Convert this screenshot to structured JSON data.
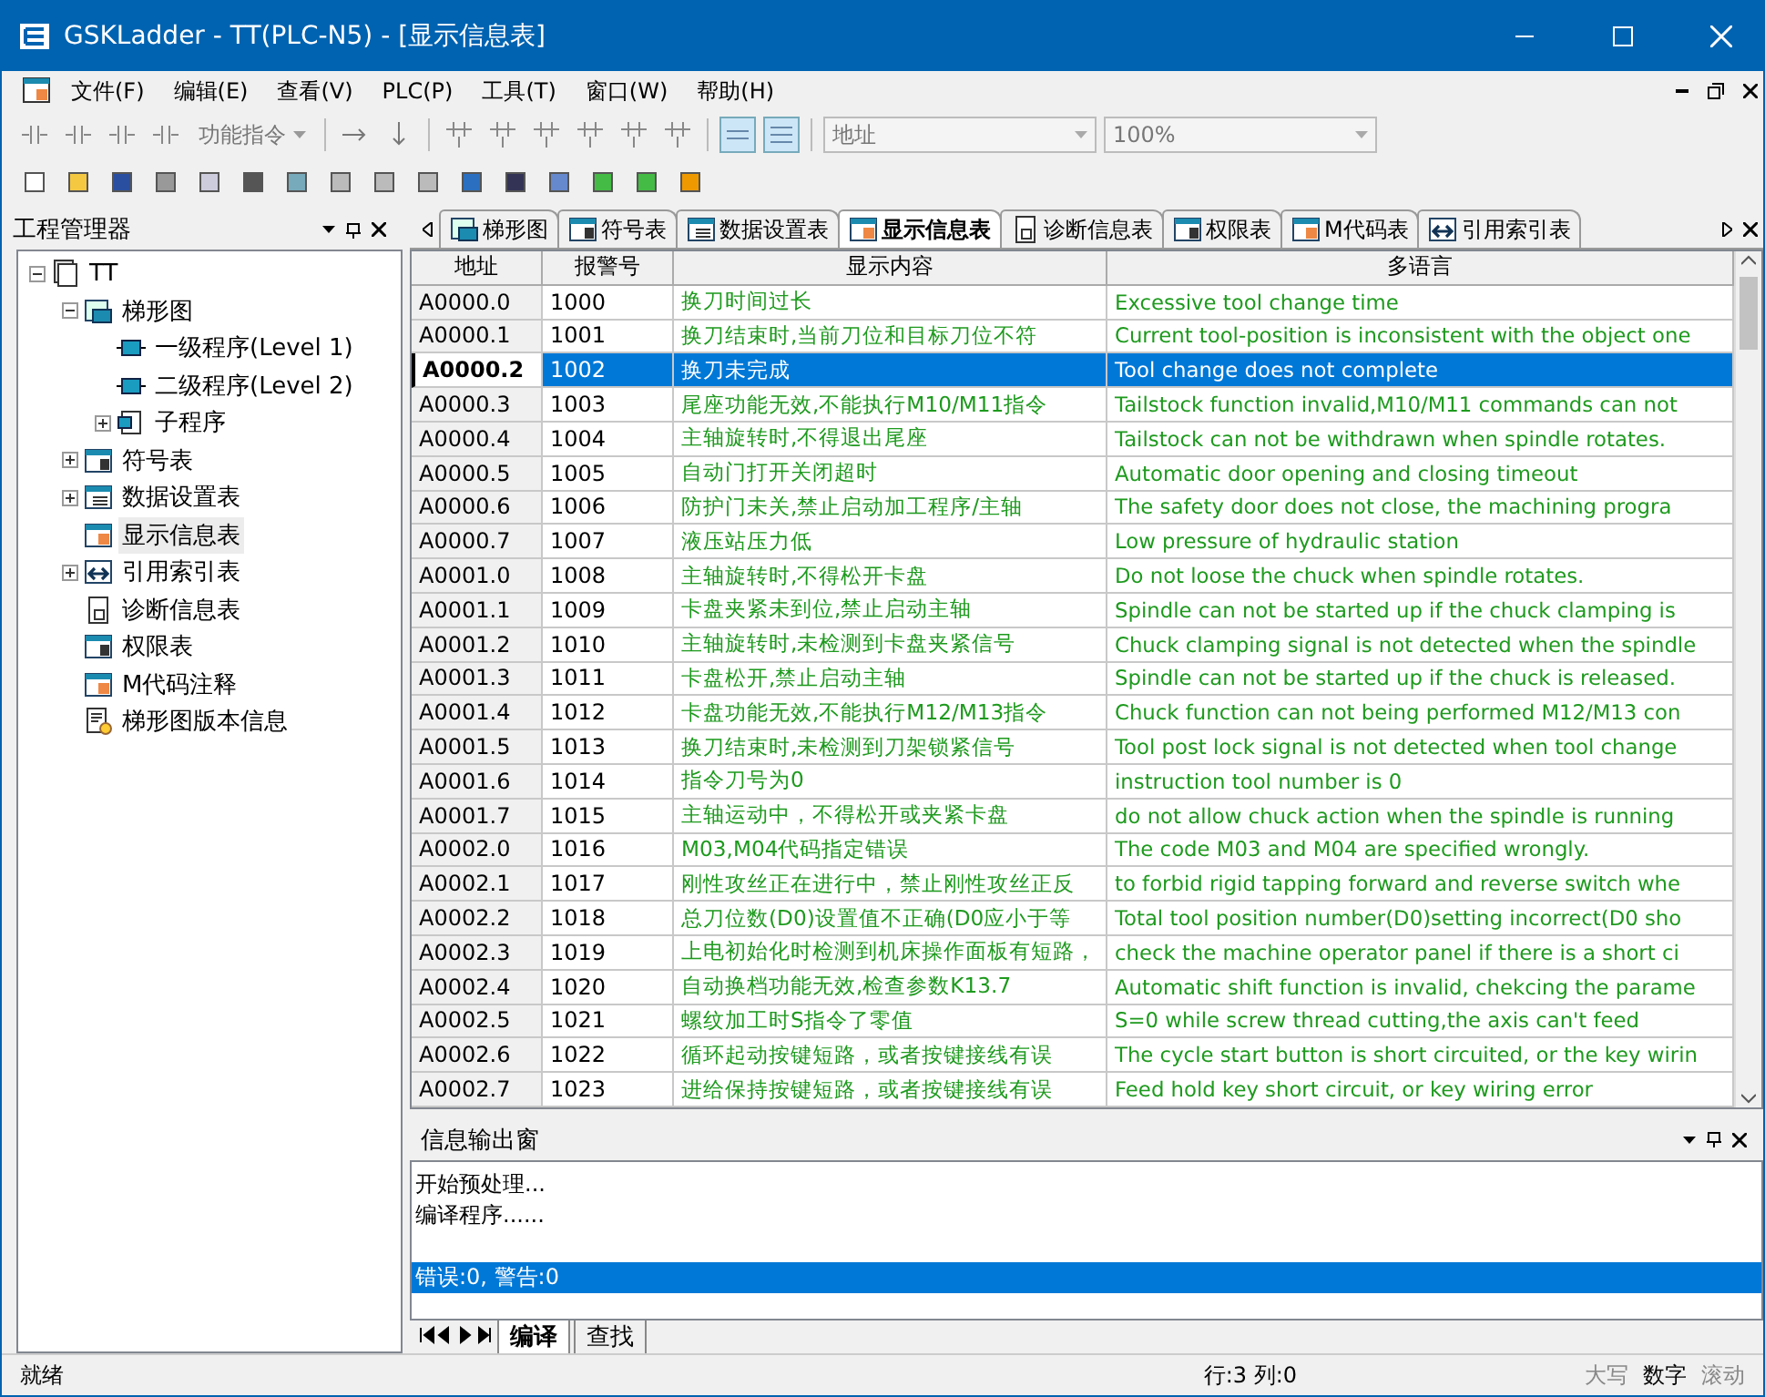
{
  "window": {
    "title": "GSKLadder - TT(PLC-N5) - [显示信息表]"
  },
  "menu": [
    "文件(F)",
    "编辑(E)",
    "查看(V)",
    "PLC(P)",
    "工具(T)",
    "窗口(W)",
    "帮助(H)"
  ],
  "toolbar": {
    "function_menu": "功能指令",
    "address_combo": "地址",
    "zoom_combo": "100%"
  },
  "project_panel": {
    "title": "工程管理器",
    "tree": [
      {
        "label": "TT",
        "kind": "project",
        "expanded": true,
        "selected": false,
        "children": [
          {
            "label": "梯形图",
            "kind": "folder",
            "expanded": true,
            "selected": false,
            "children": [
              {
                "label": "一级程序(Level 1)",
                "kind": "block",
                "selected": false
              },
              {
                "label": "二级程序(Level 2)",
                "kind": "block",
                "selected": false
              },
              {
                "label": "子程序",
                "kind": "sub",
                "expanded": false,
                "selected": false
              }
            ]
          },
          {
            "label": "符号表",
            "kind": "table",
            "expanded": false,
            "selected": false
          },
          {
            "label": "数据设置表",
            "kind": "list",
            "expanded": false,
            "selected": false
          },
          {
            "label": "显示信息表",
            "kind": "info",
            "selected": true
          },
          {
            "label": "引用索引表",
            "kind": "ref",
            "expanded": false,
            "selected": false
          },
          {
            "label": "诊断信息表",
            "kind": "doc",
            "selected": false
          },
          {
            "label": "权限表",
            "kind": "table",
            "selected": false
          },
          {
            "label": "M代码注释",
            "kind": "info",
            "selected": false
          },
          {
            "label": "梯形图版本信息",
            "kind": "version",
            "selected": false
          }
        ]
      }
    ]
  },
  "doc_tabs": [
    {
      "label": "梯形图",
      "kind": "folder",
      "selected": false
    },
    {
      "label": "符号表",
      "kind": "table",
      "selected": false
    },
    {
      "label": "数据设置表",
      "kind": "list",
      "selected": false
    },
    {
      "label": "显示信息表",
      "kind": "info",
      "selected": true
    },
    {
      "label": "诊断信息表",
      "kind": "doc",
      "selected": false
    },
    {
      "label": "权限表",
      "kind": "table",
      "selected": false
    },
    {
      "label": "M代码表",
      "kind": "info",
      "selected": false
    },
    {
      "label": "引用索引表",
      "kind": "ref",
      "selected": false
    }
  ],
  "table": {
    "columns": [
      "地址",
      "报警号",
      "显示内容",
      "多语言"
    ],
    "rows": [
      {
        "address": "A0000.0",
        "alarm": "1000",
        "content": "换刀时间过长",
        "translation": "Excessive tool change time",
        "selected": false
      },
      {
        "address": "A0000.1",
        "alarm": "1001",
        "content": "换刀结束时,当前刀位和目标刀位不符",
        "translation": "Current tool-position is inconsistent with the object one",
        "selected": false
      },
      {
        "address": "A0000.2",
        "alarm": "1002",
        "content": "换刀未完成",
        "translation": "Tool change does not complete",
        "selected": true
      },
      {
        "address": "A0000.3",
        "alarm": "1003",
        "content": "尾座功能无效,不能执行M10/M11指令",
        "translation": "Tailstock function invalid,M10/M11 commands can not",
        "selected": false
      },
      {
        "address": "A0000.4",
        "alarm": "1004",
        "content": "主轴旋转时,不得退出尾座",
        "translation": "Tailstock can not be withdrawn when spindle rotates.",
        "selected": false
      },
      {
        "address": "A0000.5",
        "alarm": "1005",
        "content": "自动门打开关闭超时",
        "translation": "Automatic door opening and closing timeout",
        "selected": false
      },
      {
        "address": "A0000.6",
        "alarm": "1006",
        "content": "防护门未关,禁止启动加工程序/主轴",
        "translation": "The safety door does not close, the machining progra",
        "selected": false
      },
      {
        "address": "A0000.7",
        "alarm": "1007",
        "content": "液压站压力低",
        "translation": "Low pressure of hydraulic station",
        "selected": false
      },
      {
        "address": "A0001.0",
        "alarm": "1008",
        "content": "主轴旋转时,不得松开卡盘",
        "translation": "Do not loose the chuck when spindle rotates.",
        "selected": false
      },
      {
        "address": "A0001.1",
        "alarm": "1009",
        "content": "卡盘夹紧未到位,禁止启动主轴",
        "translation": "Spindle can not be started up if the chuck clamping is",
        "selected": false
      },
      {
        "address": "A0001.2",
        "alarm": "1010",
        "content": "主轴旋转时,未检测到卡盘夹紧信号",
        "translation": "Chuck clamping signal is not detected when the spindle",
        "selected": false
      },
      {
        "address": "A0001.3",
        "alarm": "1011",
        "content": "卡盘松开,禁止启动主轴",
        "translation": "Spindle can not be started up if the chuck is released.",
        "selected": false
      },
      {
        "address": "A0001.4",
        "alarm": "1012",
        "content": "卡盘功能无效,不能执行M12/M13指令",
        "translation": "Chuck function can not being performed M12/M13 con",
        "selected": false
      },
      {
        "address": "A0001.5",
        "alarm": "1013",
        "content": "换刀结束时,未检测到刀架锁紧信号",
        "translation": "Tool post lock signal is not detected when tool change",
        "selected": false
      },
      {
        "address": "A0001.6",
        "alarm": "1014",
        "content": "指令刀号为0",
        "translation": "instruction tool number is 0",
        "selected": false
      },
      {
        "address": "A0001.7",
        "alarm": "1015",
        "content": "主轴运动中，不得松开或夹紧卡盘",
        "translation": "do not allow chuck action when the spindle is running",
        "selected": false
      },
      {
        "address": "A0002.0",
        "alarm": "1016",
        "content": "M03,M04代码指定错误",
        "translation": "The code M03 and M04 are specified wrongly.",
        "selected": false
      },
      {
        "address": "A0002.1",
        "alarm": "1017",
        "content": "刚性攻丝正在进行中，禁止刚性攻丝正反",
        "translation": "to forbid rigid tapping forward and reverse switch whe",
        "selected": false
      },
      {
        "address": "A0002.2",
        "alarm": "1018",
        "content": "总刀位数(D0)设置值不正确(D0应小于等",
        "translation": "Total tool position number(D0)setting incorrect(D0 sho",
        "selected": false
      },
      {
        "address": "A0002.3",
        "alarm": "1019",
        "content": "上电初始化时检测到机床操作面板有短路，",
        "translation": "check the machine operator panel if there is a short ci",
        "selected": false
      },
      {
        "address": "A0002.4",
        "alarm": "1020",
        "content": "自动换档功能无效,检查参数K13.7",
        "translation": "Automatic shift function is invalid, chekcing the parame",
        "selected": false
      },
      {
        "address": "A0002.5",
        "alarm": "1021",
        "content": "螺纹加工时S指令了零值",
        "translation": "S=0 while screw thread cutting,the axis can't feed",
        "selected": false
      },
      {
        "address": "A0002.6",
        "alarm": "1022",
        "content": "循环起动按键短路，或者按键接线有误",
        "translation": "The cycle start button is short circuited, or the key wirin",
        "selected": false
      },
      {
        "address": "A0002.7",
        "alarm": "1023",
        "content": "进给保持按键短路，或者按键接线有误",
        "translation": "Feed hold key short circuit, or key wiring error",
        "selected": false
      }
    ]
  },
  "output": {
    "title": "信息输出窗",
    "lines": [
      {
        "text": "开始预处理...",
        "selected": false
      },
      {
        "text": "编译程序......",
        "selected": false
      },
      {
        "text": "错误:0, 警告:0",
        "selected": true
      }
    ],
    "tabs": [
      {
        "label": "编译",
        "selected": true
      },
      {
        "label": "查找",
        "selected": false
      }
    ]
  },
  "status_bar": {
    "message": "就绪",
    "position": "行:3 列:0",
    "indicators": [
      {
        "label": "大写",
        "on": false
      },
      {
        "label": "数字",
        "on": true
      },
      {
        "label": "滚动",
        "on": false
      }
    ]
  }
}
